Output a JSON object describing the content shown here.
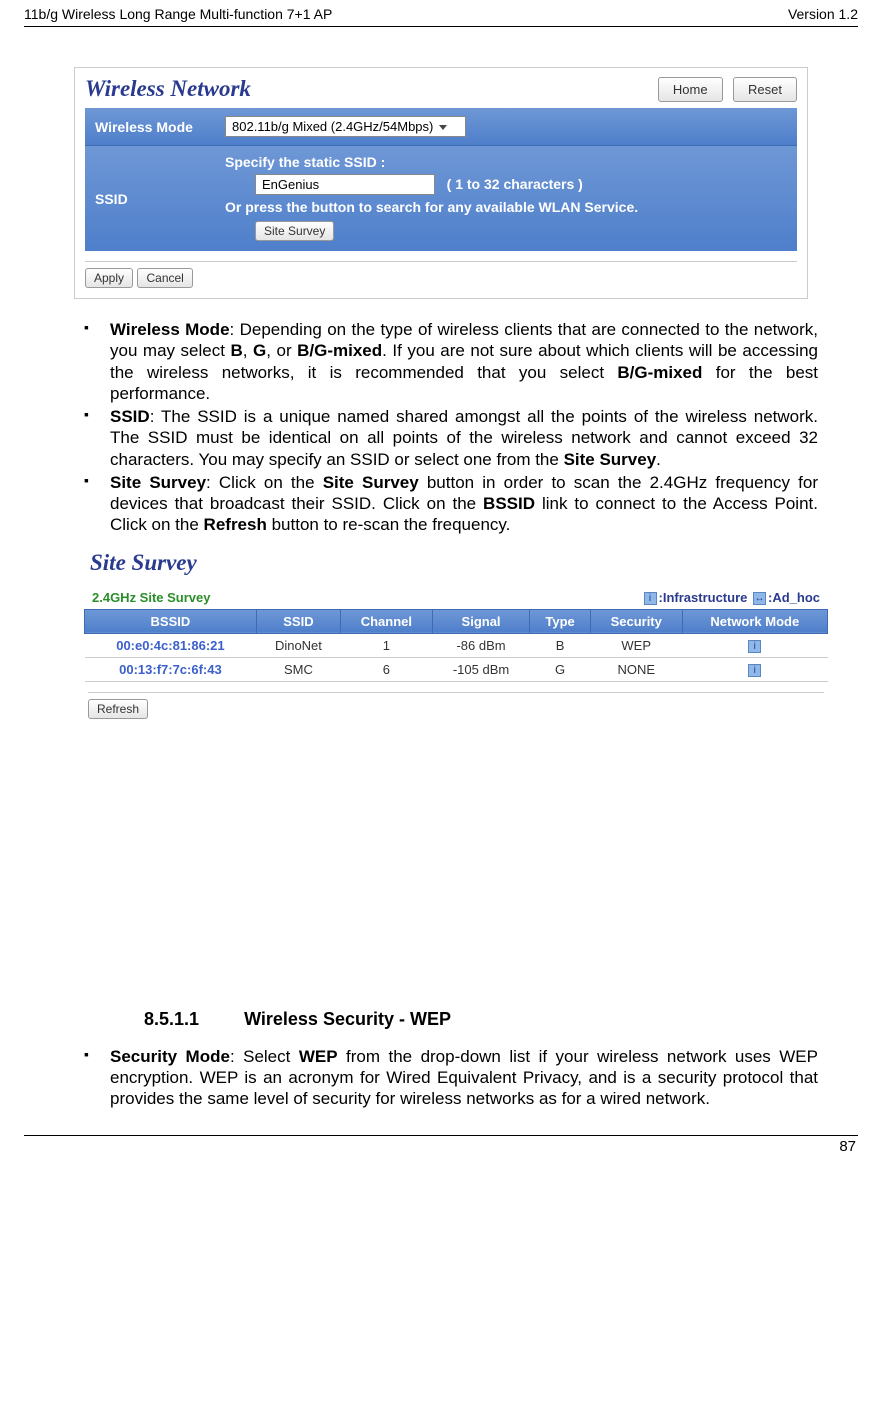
{
  "doc_header": {
    "left": "11b/g Wireless Long Range Multi-function 7+1 AP",
    "right": "Version 1.2"
  },
  "wireless_panel": {
    "title": "Wireless Network",
    "home_btn": "Home",
    "reset_btn": "Reset",
    "mode_label": "Wireless Mode",
    "mode_value": "802.11b/g Mixed (2.4GHz/54Mbps)",
    "ssid_label": "SSID",
    "ssid_spec": "Specify the static SSID  :",
    "ssid_value": "EnGenius",
    "ssid_chars": "( 1 to 32 characters )",
    "ssid_or": "Or press the button to search for any available WLAN Service.",
    "site_survey_btn": "Site Survey",
    "apply_btn": "Apply",
    "cancel_btn": "Cancel"
  },
  "bullets": {
    "b1a": "Wireless Mode",
    "b1b": ": Depending on the type of wireless clients that are connected to the network, you may select ",
    "b1_B": "B",
    "b1_c": ", ",
    "b1_G": "G",
    "b1_or": ", or ",
    "b1_BG": "B/G-mixed",
    "b1_d": ". If you are not sure about which clients will be accessing the wireless networks, it is recommended that you select ",
    "b1_BG2": "B/G-mixed",
    "b1_e": " for the best performance.",
    "b2a": "SSID",
    "b2b": ": The SSID is a unique named shared amongst all the points of the wireless network. The SSID must be identical on all points of the wireless network and cannot exceed 32 characters. You may specify an SSID or select one from the ",
    "b2_ss": "Site Survey",
    "b2_c": ".",
    "b3a": "Site Survey",
    "b3b": ": Click on the ",
    "b3_ss": "Site Survey",
    "b3_c": " button in order to scan the 2.4GHz frequency for devices that broadcast their SSID. Click on the ",
    "b3_bssid": "BSSID",
    "b3_d": " link to connect to the Access Point. Click on the ",
    "b3_ref": "Refresh",
    "b3_e": " button to re-scan the frequency."
  },
  "site_survey": {
    "title": "Site Survey",
    "legend_left": "2.4GHz Site Survey",
    "legend_infra": ":Infrastructure",
    "legend_adhoc": ":Ad_hoc",
    "headers": {
      "bssid": "BSSID",
      "ssid": "SSID",
      "channel": "Channel",
      "signal": "Signal",
      "type": "Type",
      "security": "Security",
      "mode": "Network Mode"
    },
    "rows": [
      {
        "bssid": "00:e0:4c:81:86:21",
        "ssid": "DinoNet",
        "channel": "1",
        "signal": "-86 dBm",
        "type": "B",
        "security": "WEP"
      },
      {
        "bssid": "00:13:f7:7c:6f:43",
        "ssid": "SMC",
        "channel": "6",
        "signal": "-105 dBm",
        "type": "G",
        "security": "NONE"
      }
    ],
    "refresh_btn": "Refresh"
  },
  "section": {
    "num": "8.5.1.1",
    "title": "Wireless Security - WEP"
  },
  "sec_bullet": {
    "a": "Security Mode",
    "b": ": Select ",
    "wep": "WEP",
    "c": " from the drop-down list if your wireless network uses WEP encryption. WEP is an acronym for Wired Equivalent Privacy, and is a security protocol that provides the same level of security for wireless networks as for a wired network."
  },
  "page_num": "87"
}
